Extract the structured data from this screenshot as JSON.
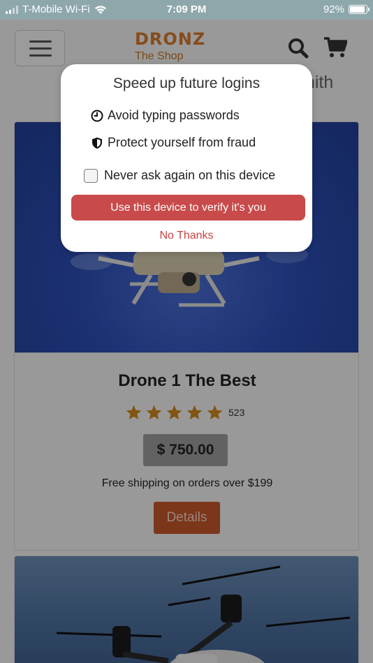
{
  "status_bar": {
    "carrier": "T-Mobile Wi-Fi",
    "time": "7:09 PM",
    "battery": "92%",
    "battery_level": 0.92
  },
  "header": {
    "brand": "DRONZ",
    "tagline": "The Shop",
    "username_fragment": "mith",
    "icons": [
      "hamburger-menu-icon",
      "search-icon",
      "cart-icon"
    ]
  },
  "product": {
    "title": "Drone 1 The Best",
    "rating": 5,
    "review_count": "523",
    "price": "$ 750.00",
    "shipping_note": "Free shipping on orders over $199",
    "details_label": "Details"
  },
  "modal": {
    "title": "Speed up future logins",
    "features": [
      {
        "icon": "clock-icon",
        "text": "Avoid typing passwords"
      },
      {
        "icon": "shield-icon",
        "text": "Protect yourself from fraud"
      }
    ],
    "checkbox_label": "Never ask again on this device",
    "checkbox_checked": false,
    "primary_button": "Use this device to verify it's you",
    "secondary_link": "No Thanks"
  },
  "colors": {
    "accent": "#c94a4a",
    "brand_orange": "#d87b2e",
    "status_bar": "#8ea7ab",
    "star": "#d08a1d"
  }
}
